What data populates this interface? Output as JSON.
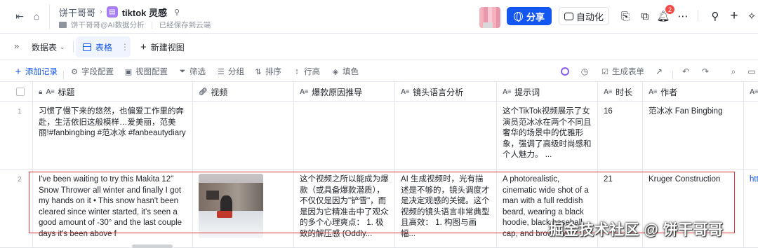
{
  "header": {
    "workspace": "饼干哥哥",
    "doc_title": "tiktok 灵感",
    "location": "饼干哥哥@AI数据分析",
    "save_status": "已经保存到云端",
    "share_label": "分享",
    "automation_label": "自动化",
    "notification_count": "2",
    "accent_color": "#1456f0",
    "icons": [
      "sidebar-toggle-icon",
      "home-icon",
      "doc-icon",
      "pin-icon",
      "globe-icon",
      "robot-icon",
      "form-icon",
      "puzzle-icon",
      "bell-icon",
      "more-icon",
      "search-icon",
      "plus-icon",
      "ai-sparkle-icon"
    ]
  },
  "viewbar": {
    "data_table_label": "数据表",
    "active_view_label": "表格",
    "new_view_label": "新建视图"
  },
  "toolbar": {
    "add_record": "添加记录",
    "field_config": "字段配置",
    "view_config": "视图配置",
    "filter": "筛选",
    "group": "分组",
    "sort": "排序",
    "row_height": "行高",
    "fill_color": "填色",
    "generate_form": "生成表单"
  },
  "table": {
    "columns": [
      {
        "name": "标题",
        "type": "A≡",
        "locked": true
      },
      {
        "name": "视频",
        "type": "attachment"
      },
      {
        "name": "爆款原因推导",
        "type": "A≡"
      },
      {
        "name": "镜头语言分析",
        "type": "A≡"
      },
      {
        "name": "提示词",
        "type": "A≡"
      },
      {
        "name": "时长",
        "type": "A≡"
      },
      {
        "name": "作者",
        "type": "A≡"
      }
    ],
    "rows": [
      {
        "num": "1",
        "title": "习惯了慢下来的悠然，也偏爱工作里的奔赴，生活依旧这般模样…爱美丽，范美丽!#fanbingbing #范冰冰 #fanbeautydiary",
        "reason": "",
        "shot": "",
        "prompt": "这个TikTok视频展示了女演员范冰冰在两个不同且奢华的场景中的优雅形象，强调了高级时尚感和个人魅力。 ...",
        "duration": "16",
        "author": "范冰冰 Fan Bingbing"
      },
      {
        "num": "2",
        "title": "I've been waiting to try this Makita 12\" Snow Thrower all winter and finally I got my hands on it • This snow hasn't been cleared since winter started, it's seen a good amount of  -30° and the last couple days it's been above f",
        "reason": "这个视频之所以能成为爆款（或具备爆款潜质），不仅仅是因为\"铲雪\"，而是因为它精准击中了观众的多个心理爽点： 1. 极致的解压感 (Oddly...",
        "shot": "AI 生成视频时，光有描述是不够的，镜头调度才是决定观感的关键。这个视频的镜头语言非常典型且高效： 1. 构图与画幅...",
        "prompt": "A photorealistic, cinematic wide shot of a man with a full reddish beard, wearing a black hoodie, black baseball cap, and brown work...",
        "duration": "21",
        "author": "Kruger Construction",
        "link_fragment": "htt"
      }
    ]
  },
  "watermark": "掘金技术社区 @ 饼干哥哥"
}
